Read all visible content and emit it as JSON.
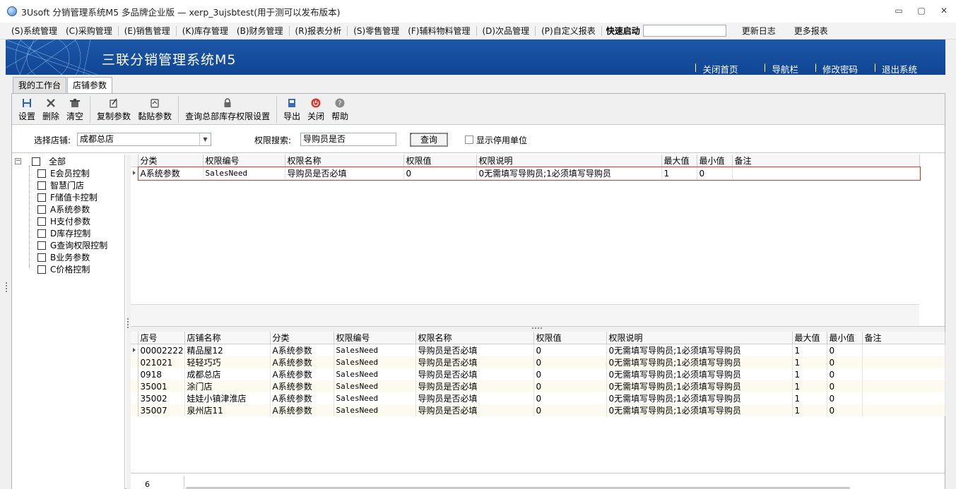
{
  "window": {
    "title": "3Usoft 分销管理系统M5 多品牌企业版 — xerp_3ujsbtest(用于测可以发布版本)",
    "controls": [
      "▭",
      "▢",
      "✕"
    ]
  },
  "menu": {
    "items": [
      "(S)系统管理",
      "(C)采购管理",
      "(E)销售管理",
      "(K)库存管理",
      "(B)财务管理",
      "(R)报表分析",
      "(S)零售管理",
      "(F)辅料物料管理",
      "(D)次品管理",
      "(P)自定义报表"
    ],
    "quick_start_label": "快速启动",
    "quick_start_value": "",
    "extra": [
      "更新日志",
      "更多报表"
    ]
  },
  "banner": {
    "title": "三联分销管理系统M5",
    "links": [
      "关闭首页",
      "导航栏",
      "修改密码",
      "退出系统"
    ]
  },
  "tabs": [
    {
      "label": "我的工作台",
      "active": false
    },
    {
      "label": "店铺参数",
      "active": true
    }
  ],
  "toolbar": {
    "buttons": [
      {
        "label": "设置",
        "icon": "save-icon"
      },
      {
        "label": "删除",
        "icon": "delete-icon"
      },
      {
        "label": "清空",
        "icon": "trash-icon"
      },
      {
        "label": "复制参数",
        "icon": "copy-icon"
      },
      {
        "label": "黏贴参数",
        "icon": "paste-icon"
      },
      {
        "label": "查询总部库存权限设置",
        "icon": "lock-icon"
      },
      {
        "label": "导出",
        "icon": "export-icon"
      },
      {
        "label": "关闭",
        "icon": "power-icon"
      },
      {
        "label": "帮助",
        "icon": "help-icon"
      }
    ]
  },
  "filter": {
    "store_label": "选择店铺:",
    "store_value": "成都总店",
    "search_label": "权限搜索:",
    "search_value": "导购员是否",
    "query_label": "查询",
    "show_disabled_label": "显示停用单位",
    "show_disabled_checked": false
  },
  "tree": {
    "root": "全部",
    "expander": "⊟",
    "items": [
      "E会员控制",
      "智慧门店",
      "F储值卡控制",
      "A系统参数",
      "H支付参数",
      "D库存控制",
      "G查询权限控制",
      "B业务参数",
      "C价格控制"
    ]
  },
  "upper_grid": {
    "columns": [
      "分类",
      "权限编号",
      "权限名称",
      "权限值",
      "权限说明",
      "最大值",
      "最小值",
      "备注"
    ],
    "rows": [
      [
        "A系统参数",
        "SalesNeed",
        "导购员是否必填",
        "0",
        "0无需填写导购员;1必须填写导购员",
        "1",
        "0",
        ""
      ]
    ]
  },
  "lower_grid": {
    "columns": [
      "店号",
      "店铺名称",
      "分类",
      "权限编号",
      "权限名称",
      "权限值",
      "权限说明",
      "最大值",
      "最小值",
      "备注"
    ],
    "rows": [
      [
        "00002222",
        "精品屋12",
        "A系统参数",
        "SalesNeed",
        "导购员是否必填",
        "0",
        "0无需填写导购员;1必须填写导购员",
        "1",
        "0",
        ""
      ],
      [
        "021021",
        "轻轻巧巧",
        "A系统参数",
        "SalesNeed",
        "导购员是否必填",
        "0",
        "0无需填写导购员;1必须填写导购员",
        "1",
        "0",
        ""
      ],
      [
        "0918",
        "成都总店",
        "A系统参数",
        "SalesNeed",
        "导购员是否必填",
        "0",
        "0无需填写导购员;1必须填写导购员",
        "1",
        "0",
        ""
      ],
      [
        "35001",
        "涂门店",
        "A系统参数",
        "SalesNeed",
        "导购员是否必填",
        "0",
        "0无需填写导购员;1必须填写导购员",
        "1",
        "0",
        ""
      ],
      [
        "35002",
        "娃娃小镇津淮店",
        "A系统参数",
        "SalesNeed",
        "导购员是否必填",
        "0",
        "0无需填写导购员;1必须填写导购员",
        "1",
        "0",
        ""
      ],
      [
        "35007",
        "泉州店11",
        "A系统参数",
        "SalesNeed",
        "导购员是否必填",
        "0",
        "0无需填写导购员;1必须填写导购员",
        "1",
        "0",
        ""
      ]
    ],
    "row_count": "6"
  },
  "colors": {
    "banner_blue": "#1d57a8",
    "highlight_red": "#d9382e",
    "alt_row": "#fdfbef"
  }
}
